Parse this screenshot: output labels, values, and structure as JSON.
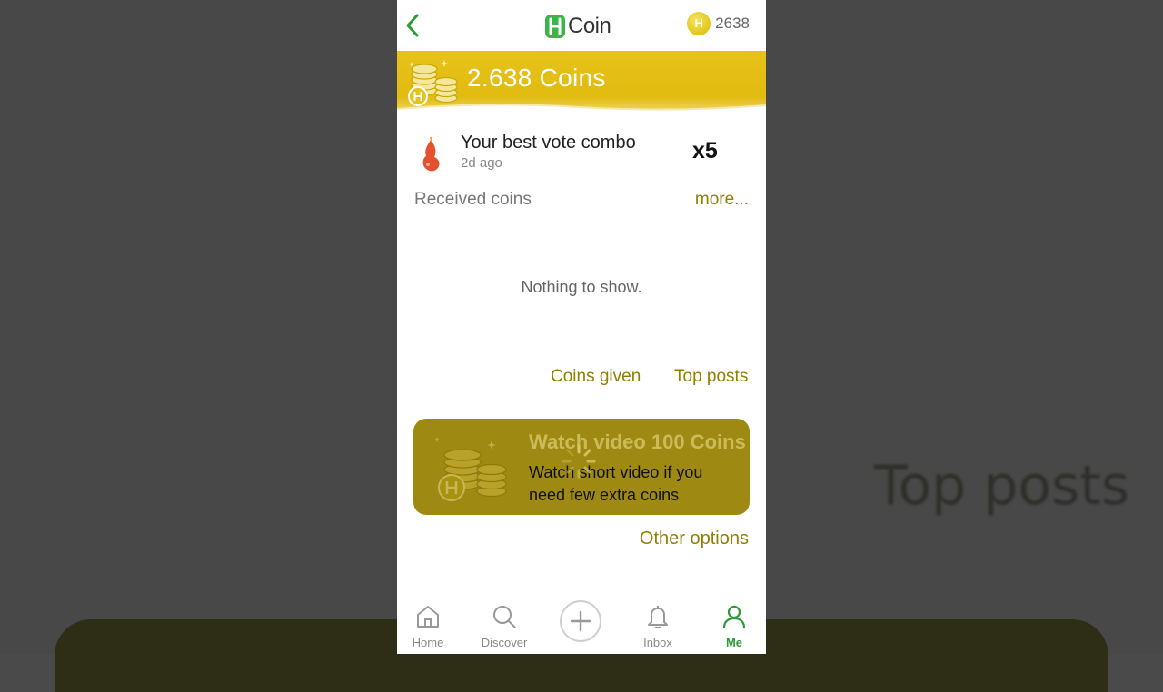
{
  "header": {
    "logo_text": "Coin",
    "balance_coin_symbol": "H",
    "balance": "2638"
  },
  "banner": {
    "coins_total": "2.638 Coins"
  },
  "combo": {
    "title": "Your best vote combo",
    "time": "2d ago",
    "multiplier": "x5"
  },
  "received": {
    "label": "Received coins",
    "more": "more...",
    "empty": "Nothing to show."
  },
  "links": {
    "coins_given": "Coins given",
    "top_posts": "Top posts"
  },
  "video_card": {
    "title": "Watch video 100 Coins",
    "description": "Watch short video if you need few extra coins"
  },
  "other_options": "Other options",
  "nav": {
    "items": [
      {
        "label": "Home",
        "icon": "home-icon"
      },
      {
        "label": "Discover",
        "icon": "search-icon"
      },
      {
        "label": "",
        "icon": "plus-icon"
      },
      {
        "label": "Inbox",
        "icon": "bell-icon"
      },
      {
        "label": "Me",
        "icon": "user-icon"
      }
    ],
    "active": "Me"
  },
  "background_text": "Top posts",
  "colors": {
    "accent_green": "#39b54a",
    "banner_gold": "#e1bb10",
    "link_olive": "#8f8000",
    "nav_active": "#2e9a3a"
  }
}
